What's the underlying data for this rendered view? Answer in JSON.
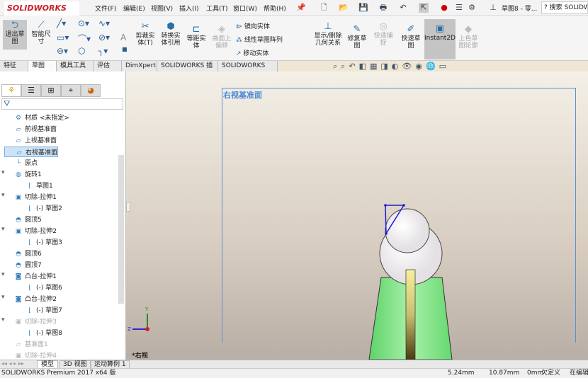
{
  "app": {
    "logo": "SOLIDWORKS",
    "doc_title": "草图8 - 零...",
    "search_placeholder": "搜索 SOLIDWORKS"
  },
  "menu": [
    "文件(F)",
    "编辑(E)",
    "视图(V)",
    "插入(I)",
    "工具(T)",
    "窗口(W)",
    "帮助(H)"
  ],
  "ribbon": {
    "exit_sketch": "退出草图",
    "smart_dim": "智能尺寸",
    "trim": "剪裁实体(T)",
    "convert": "转换实体引用",
    "offset": "等距实体",
    "surface_offset": "曲面上偏移",
    "mirror": "镜向实体",
    "linear_pattern": "线性草图阵列",
    "move": "移动实体",
    "relations": "显示/删除几何关系",
    "repair": "修复草图",
    "quick_snap": "快速捕捉",
    "rapid_sketch": "快速草图",
    "instant2d": "Instant2D",
    "shaded_sketch": "上色草图轮廓"
  },
  "tabs": [
    "特征",
    "草图",
    "模具工具",
    "评估",
    "DimXpert",
    "SOLIDWORKS 插件",
    "SOLIDWORKS MBD"
  ],
  "tree": [
    {
      "label": "材质 <未指定>",
      "icon": "material-icon",
      "level": 0
    },
    {
      "label": "前视基准面",
      "icon": "plane-icon",
      "level": 0
    },
    {
      "label": "上视基准面",
      "icon": "plane-icon",
      "level": 0
    },
    {
      "label": "右视基准面",
      "icon": "plane-icon",
      "level": 0,
      "selected": true
    },
    {
      "label": "原点",
      "icon": "origin-icon",
      "level": 0
    },
    {
      "label": "旋转1",
      "icon": "revolve-icon",
      "level": 0,
      "expand": true
    },
    {
      "label": "草图1",
      "icon": "sketch-icon",
      "level": 1
    },
    {
      "label": "切除-拉伸1",
      "icon": "cut-extrude-icon",
      "level": 0,
      "expand": true
    },
    {
      "label": "(-) 草图2",
      "icon": "sketch-icon",
      "level": 1
    },
    {
      "label": "圆顶5",
      "icon": "dome-icon",
      "level": 0
    },
    {
      "label": "切除-拉伸2",
      "icon": "cut-extrude-icon",
      "level": 0,
      "expand": true
    },
    {
      "label": "(-) 草图3",
      "icon": "sketch-icon",
      "level": 1
    },
    {
      "label": "圆顶6",
      "icon": "dome-icon",
      "level": 0
    },
    {
      "label": "圆顶7",
      "icon": "dome-icon",
      "level": 0
    },
    {
      "label": "凸台-拉伸1",
      "icon": "boss-extrude-icon",
      "level": 0,
      "expand": true
    },
    {
      "label": "(-) 草图6",
      "icon": "sketch-icon",
      "level": 1
    },
    {
      "label": "凸台-拉伸2",
      "icon": "boss-extrude-icon",
      "level": 0,
      "expand": true
    },
    {
      "label": "(-) 草图7",
      "icon": "sketch-icon",
      "level": 1
    },
    {
      "label": "切除-拉伸3",
      "icon": "cut-extrude-icon",
      "level": 0,
      "expand": true,
      "gray": true
    },
    {
      "label": "(-) 草图8",
      "icon": "sketch-icon",
      "level": 1
    },
    {
      "label": "基准面1",
      "icon": "plane-icon",
      "level": 0,
      "gray": true
    },
    {
      "label": "切除-拉伸4",
      "icon": "cut-extrude-icon",
      "level": 0,
      "gray": true
    }
  ],
  "viewport": {
    "plane_label": "右视基准面",
    "view_label": "*右视",
    "axis_y": "Y",
    "axis_z": "Z"
  },
  "bottom_tabs": [
    "模型",
    "3D 视图",
    "运动算例 1"
  ],
  "status": {
    "product": "SOLIDWORKS Premium 2017 x64 版",
    "x": "5.24mm",
    "y": "10.87mm",
    "z": "0mm",
    "state": "欠定义",
    "mode": "在编辑"
  }
}
